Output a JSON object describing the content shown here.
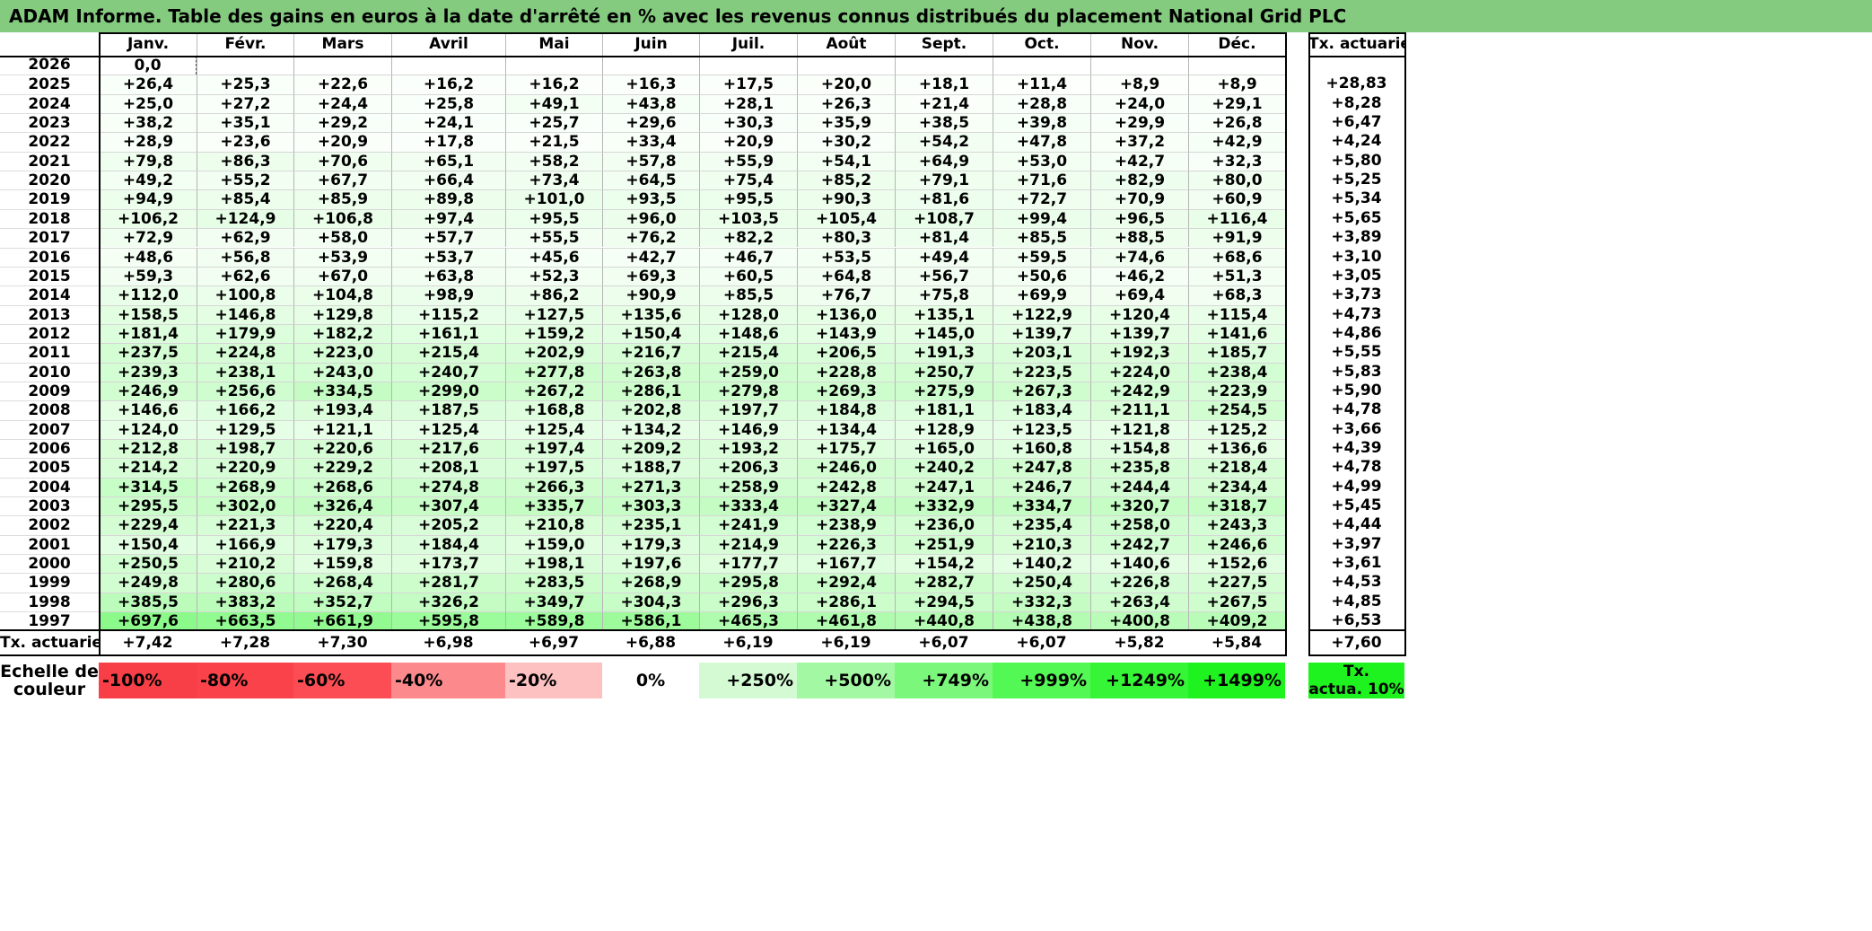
{
  "title": "ADAM Informe. Table des gains en euros à la date d'arrêté en % avec les revenus connus distribués du placement National Grid PLC",
  "months": [
    "Janv.",
    "Févr.",
    "Mars",
    "Avril",
    "Mai",
    "Juin",
    "Juil.",
    "Août",
    "Sept.",
    "Oct.",
    "Nov.",
    "Déc."
  ],
  "rate_header": "Tx. actuariel",
  "rows": [
    {
      "year": "2026",
      "values": [
        "0,0",
        "",
        "",
        "",
        "",
        "",
        "",
        "",
        "",
        "",
        "",
        ""
      ],
      "rate": ""
    },
    {
      "year": "2025",
      "values": [
        "+26,4",
        "+25,3",
        "+22,6",
        "+16,2",
        "+16,2",
        "+16,3",
        "+17,5",
        "+20,0",
        "+18,1",
        "+11,4",
        "+8,9",
        "+8,9"
      ],
      "rate": "+28,83"
    },
    {
      "year": "2024",
      "values": [
        "+25,0",
        "+27,2",
        "+24,4",
        "+25,8",
        "+49,1",
        "+43,8",
        "+28,1",
        "+26,3",
        "+21,4",
        "+28,8",
        "+24,0",
        "+29,1"
      ],
      "rate": "+8,28"
    },
    {
      "year": "2023",
      "values": [
        "+38,2",
        "+35,1",
        "+29,2",
        "+24,1",
        "+25,7",
        "+29,6",
        "+30,3",
        "+35,9",
        "+38,5",
        "+39,8",
        "+29,9",
        "+26,8"
      ],
      "rate": "+6,47"
    },
    {
      "year": "2022",
      "values": [
        "+28,9",
        "+23,6",
        "+20,9",
        "+17,8",
        "+21,5",
        "+33,4",
        "+20,9",
        "+30,2",
        "+54,2",
        "+47,8",
        "+37,2",
        "+42,9"
      ],
      "rate": "+4,24"
    },
    {
      "year": "2021",
      "values": [
        "+79,8",
        "+86,3",
        "+70,6",
        "+65,1",
        "+58,2",
        "+57,8",
        "+55,9",
        "+54,1",
        "+64,9",
        "+53,0",
        "+42,7",
        "+32,3"
      ],
      "rate": "+5,80"
    },
    {
      "year": "2020",
      "values": [
        "+49,2",
        "+55,2",
        "+67,7",
        "+66,4",
        "+73,4",
        "+64,5",
        "+75,4",
        "+85,2",
        "+79,1",
        "+71,6",
        "+82,9",
        "+80,0"
      ],
      "rate": "+5,25"
    },
    {
      "year": "2019",
      "values": [
        "+94,9",
        "+85,4",
        "+85,9",
        "+89,8",
        "+101,0",
        "+93,5",
        "+95,5",
        "+90,3",
        "+81,6",
        "+72,7",
        "+70,9",
        "+60,9"
      ],
      "rate": "+5,34"
    },
    {
      "year": "2018",
      "values": [
        "+106,2",
        "+124,9",
        "+106,8",
        "+97,4",
        "+95,5",
        "+96,0",
        "+103,5",
        "+105,4",
        "+108,7",
        "+99,4",
        "+96,5",
        "+116,4"
      ],
      "rate": "+5,65"
    },
    {
      "year": "2017",
      "values": [
        "+72,9",
        "+62,9",
        "+58,0",
        "+57,7",
        "+55,5",
        "+76,2",
        "+82,2",
        "+80,3",
        "+81,4",
        "+85,5",
        "+88,5",
        "+91,9"
      ],
      "rate": "+3,89"
    },
    {
      "year": "2016",
      "values": [
        "+48,6",
        "+56,8",
        "+53,9",
        "+53,7",
        "+45,6",
        "+42,7",
        "+46,7",
        "+53,5",
        "+49,4",
        "+59,5",
        "+74,6",
        "+68,6"
      ],
      "rate": "+3,10"
    },
    {
      "year": "2015",
      "values": [
        "+59,3",
        "+62,6",
        "+67,0",
        "+63,8",
        "+52,3",
        "+69,3",
        "+60,5",
        "+64,8",
        "+56,7",
        "+50,6",
        "+46,2",
        "+51,3"
      ],
      "rate": "+3,05"
    },
    {
      "year": "2014",
      "values": [
        "+112,0",
        "+100,8",
        "+104,8",
        "+98,9",
        "+86,2",
        "+90,9",
        "+85,5",
        "+76,7",
        "+75,8",
        "+69,9",
        "+69,4",
        "+68,3"
      ],
      "rate": "+3,73"
    },
    {
      "year": "2013",
      "values": [
        "+158,5",
        "+146,8",
        "+129,8",
        "+115,2",
        "+127,5",
        "+135,6",
        "+128,0",
        "+136,0",
        "+135,1",
        "+122,9",
        "+120,4",
        "+115,4"
      ],
      "rate": "+4,73"
    },
    {
      "year": "2012",
      "values": [
        "+181,4",
        "+179,9",
        "+182,2",
        "+161,1",
        "+159,2",
        "+150,4",
        "+148,6",
        "+143,9",
        "+145,0",
        "+139,7",
        "+139,7",
        "+141,6"
      ],
      "rate": "+4,86"
    },
    {
      "year": "2011",
      "values": [
        "+237,5",
        "+224,8",
        "+223,0",
        "+215,4",
        "+202,9",
        "+216,7",
        "+215,4",
        "+206,5",
        "+191,3",
        "+203,1",
        "+192,3",
        "+185,7"
      ],
      "rate": "+5,55"
    },
    {
      "year": "2010",
      "values": [
        "+239,3",
        "+238,1",
        "+243,0",
        "+240,7",
        "+277,8",
        "+263,8",
        "+259,0",
        "+228,8",
        "+250,7",
        "+223,5",
        "+224,0",
        "+238,4"
      ],
      "rate": "+5,83"
    },
    {
      "year": "2009",
      "values": [
        "+246,9",
        "+256,6",
        "+334,5",
        "+299,0",
        "+267,2",
        "+286,1",
        "+279,8",
        "+269,3",
        "+275,9",
        "+267,3",
        "+242,9",
        "+223,9"
      ],
      "rate": "+5,90"
    },
    {
      "year": "2008",
      "values": [
        "+146,6",
        "+166,2",
        "+193,4",
        "+187,5",
        "+168,8",
        "+202,8",
        "+197,7",
        "+184,8",
        "+181,1",
        "+183,4",
        "+211,1",
        "+254,5"
      ],
      "rate": "+4,78"
    },
    {
      "year": "2007",
      "values": [
        "+124,0",
        "+129,5",
        "+121,1",
        "+125,4",
        "+125,4",
        "+134,2",
        "+146,9",
        "+134,4",
        "+128,9",
        "+123,5",
        "+121,8",
        "+125,2"
      ],
      "rate": "+3,66"
    },
    {
      "year": "2006",
      "values": [
        "+212,8",
        "+198,7",
        "+220,6",
        "+217,6",
        "+197,4",
        "+209,2",
        "+193,2",
        "+175,7",
        "+165,0",
        "+160,8",
        "+154,8",
        "+136,6"
      ],
      "rate": "+4,39"
    },
    {
      "year": "2005",
      "values": [
        "+214,2",
        "+220,9",
        "+229,2",
        "+208,1",
        "+197,5",
        "+188,7",
        "+206,3",
        "+246,0",
        "+240,2",
        "+247,8",
        "+235,8",
        "+218,4"
      ],
      "rate": "+4,78"
    },
    {
      "year": "2004",
      "values": [
        "+314,5",
        "+268,9",
        "+268,6",
        "+274,8",
        "+266,3",
        "+271,3",
        "+258,9",
        "+242,8",
        "+247,1",
        "+246,7",
        "+244,4",
        "+234,4"
      ],
      "rate": "+4,99"
    },
    {
      "year": "2003",
      "values": [
        "+295,5",
        "+302,0",
        "+326,4",
        "+307,4",
        "+335,7",
        "+303,3",
        "+333,4",
        "+327,4",
        "+332,9",
        "+334,7",
        "+320,7",
        "+318,7"
      ],
      "rate": "+5,45"
    },
    {
      "year": "2002",
      "values": [
        "+229,4",
        "+221,3",
        "+220,4",
        "+205,2",
        "+210,8",
        "+235,1",
        "+241,9",
        "+238,9",
        "+236,0",
        "+235,4",
        "+258,0",
        "+243,3"
      ],
      "rate": "+4,44"
    },
    {
      "year": "2001",
      "values": [
        "+150,4",
        "+166,9",
        "+179,3",
        "+184,4",
        "+159,0",
        "+179,3",
        "+214,9",
        "+226,3",
        "+251,9",
        "+210,3",
        "+242,7",
        "+246,6"
      ],
      "rate": "+3,97"
    },
    {
      "year": "2000",
      "values": [
        "+250,5",
        "+210,2",
        "+159,8",
        "+173,7",
        "+198,1",
        "+197,6",
        "+177,7",
        "+167,7",
        "+154,2",
        "+140,2",
        "+140,6",
        "+152,6"
      ],
      "rate": "+3,61"
    },
    {
      "year": "1999",
      "values": [
        "+249,8",
        "+280,6",
        "+268,4",
        "+281,7",
        "+283,5",
        "+268,9",
        "+295,8",
        "+292,4",
        "+282,7",
        "+250,4",
        "+226,8",
        "+227,5"
      ],
      "rate": "+4,53"
    },
    {
      "year": "1998",
      "values": [
        "+385,5",
        "+383,2",
        "+352,7",
        "+326,2",
        "+349,7",
        "+304,3",
        "+296,3",
        "+286,1",
        "+294,5",
        "+332,3",
        "+263,4",
        "+267,5"
      ],
      "rate": "+4,85"
    },
    {
      "year": "1997",
      "values": [
        "+697,6",
        "+663,5",
        "+661,9",
        "+595,8",
        "+589,8",
        "+586,1",
        "+465,3",
        "+461,8",
        "+440,8",
        "+438,8",
        "+400,8",
        "+409,2"
      ],
      "rate": "+6,53"
    }
  ],
  "footer": {
    "label": "Tx. actuariel",
    "values": [
      "+7,42",
      "+7,28",
      "+7,30",
      "+6,98",
      "+6,97",
      "+6,88",
      "+6,19",
      "+6,19",
      "+6,07",
      "+6,07",
      "+5,82",
      "+5,84"
    ],
    "rate": "+7,60"
  },
  "scale": {
    "label_line1": "Echelle de",
    "label_line2": "couleur",
    "items": [
      {
        "text": "-100%",
        "color": "#f83f47",
        "align": "left"
      },
      {
        "text": "-80%",
        "color": "#f9424a",
        "align": "left"
      },
      {
        "text": "-60%",
        "color": "#fb4d53",
        "align": "left"
      },
      {
        "text": "-40%",
        "color": "#fc8a8d",
        "align": "left"
      },
      {
        "text": "-20%",
        "color": "#fec1c2",
        "align": "left"
      },
      {
        "text": "0%",
        "color": "#ffffff",
        "align": "center"
      },
      {
        "text": "+250%",
        "color": "#d3fad3",
        "align": "right"
      },
      {
        "text": "+500%",
        "color": "#a3f9a3",
        "align": "right"
      },
      {
        "text": "+749%",
        "color": "#7bf87b",
        "align": "right"
      },
      {
        "text": "+999%",
        "color": "#54f854",
        "align": "right"
      },
      {
        "text": "+1249%",
        "color": "#36f536",
        "align": "right"
      },
      {
        "text": "+1499%",
        "color": "#1ff31f",
        "align": "right"
      }
    ],
    "rate_line1": "Tx.",
    "rate_line2": "actua. 10%",
    "rate_color": "#1ff31f"
  },
  "colors": {
    "title_bg": "#84ca7f",
    "positive_max": "#8cfa8a",
    "positive_min": "#ffffff"
  }
}
